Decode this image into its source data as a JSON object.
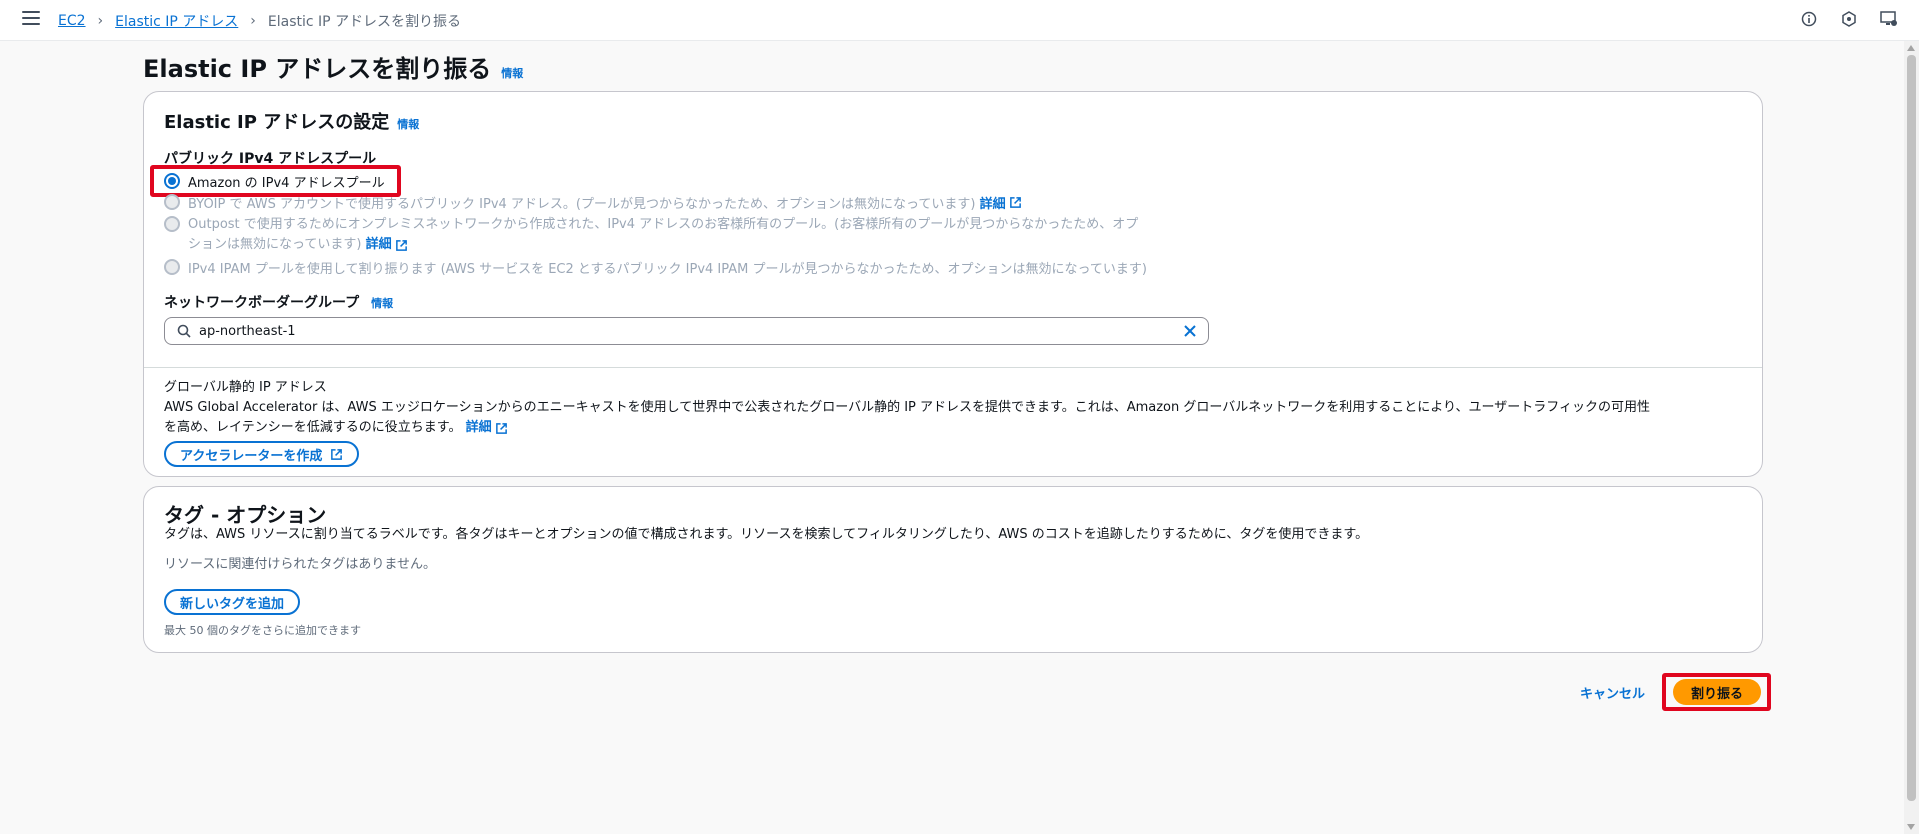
{
  "breadcrumb": {
    "items": [
      "EC2",
      "Elastic IP アドレス"
    ],
    "current": "Elastic IP アドレスを割り振る"
  },
  "page": {
    "title": "Elastic IP アドレスを割り振る",
    "info": "情報"
  },
  "settings": {
    "title": "Elastic IP アドレスの設定",
    "info": "情報",
    "pool_label": "パブリック IPv4 アドレスプール",
    "options": [
      {
        "label": "Amazon の IPv4 アドレスプール",
        "selected": true,
        "disabled": false
      },
      {
        "label": "BYOIP で AWS アカウントで使用するパブリック IPv4 アドレス。(プールが見つからなかったため、オプションは無効になっています)",
        "link": "詳細",
        "selected": false,
        "disabled": true
      },
      {
        "label": "Outpost で使用するためにオンプレミスネットワークから作成された、IPv4 アドレスのお客様所有のプール。(お客様所有のプールが見つからなかったため、オプ",
        "label2": "ションは無効になっています)",
        "link": "詳細",
        "selected": false,
        "disabled": true
      },
      {
        "label": "IPv4 IPAM プールを使用して割り振ります (AWS サービスを EC2 とするパブリック IPv4 IPAM プールが見つからなかったため、オプションは無効になっています)",
        "selected": false,
        "disabled": true
      }
    ],
    "nbg_label": "ネットワークボーダーグループ",
    "nbg_info": "情報",
    "nbg_value": "ap-northeast-1"
  },
  "global": {
    "title": "グローバル静的 IP アドレス",
    "desc1": "AWS Global Accelerator は、AWS エッジロケーションからのエニーキャストを使用して世界中で公表されたグローバル静的 IP アドレスを提供できます。これは、Amazon グローバルネットワークを利用することにより、ユーザートラフィックの可用性",
    "desc2": "を高め、レイテンシーを低減するのに役立ちます。",
    "link": "詳細",
    "button": "アクセラレーターを作成"
  },
  "tags": {
    "title": "タグ - オプション",
    "desc": "タグは、AWS リソースに割り当てるラベルです。各タグはキーとオプションの値で構成されます。リソースを検索してフィルタリングしたり、AWS のコストを追跡したりするために、タグを使用できます。",
    "empty": "リソースに関連付けられたタグはありません。",
    "add_button": "新しいタグを追加",
    "limit": "最大 50 個のタグをさらに追加できます"
  },
  "actions": {
    "cancel": "キャンセル",
    "allocate": "割り振る"
  },
  "colors": {
    "accent": "#0972d3",
    "primary_button": "#ff9900",
    "highlight": "#e0061f"
  }
}
